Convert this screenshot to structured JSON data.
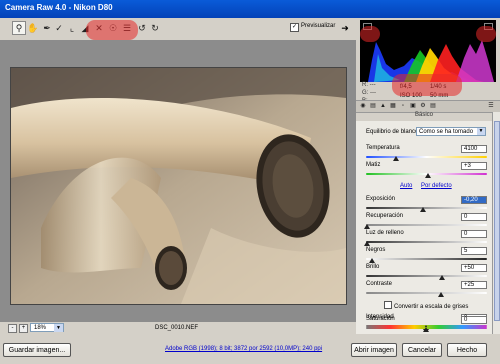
{
  "window": {
    "title": "Camera Raw 4.0  -  Nikon D80"
  },
  "toolbar": {
    "tools": [
      "zoom-icon",
      "hand-icon",
      "eyedropper-icon",
      "color-sampler-icon",
      "crop-icon",
      "straighten-icon",
      "retouch-icon",
      "red-eye-icon",
      "preferences-icon",
      "rotate-left-icon",
      "rotate-right-icon"
    ],
    "preview_label": "Previsualizar",
    "preview_checked": "✓"
  },
  "viewer": {
    "zoom": "18%",
    "filename": "DSC_0010.NEF"
  },
  "rgb": {
    "r_label": "R:",
    "g_label": "G:",
    "b_label": "B:",
    "r": "---",
    "g": "---",
    "b": "---"
  },
  "exif": {
    "aperture": "f/4,5",
    "shutter": "1/40 s",
    "iso": "ISO 100",
    "focal": "50 mm"
  },
  "panel": {
    "section_title": "Básico",
    "wb_label": "Equilibrio de blancos:",
    "wb_value": "Como se ha tomado",
    "temperatura_label": "Temperatura",
    "temperatura_value": "4100",
    "matiz_label": "Matiz",
    "matiz_value": "+3",
    "auto_label": "Auto",
    "defecto_label": "Por defecto",
    "exposicion_label": "Exposición",
    "exposicion_value": "-0,20",
    "recuperacion_label": "Recuperación",
    "recuperacion_value": "0",
    "luz_label": "Luz de relleno",
    "luz_value": "0",
    "negros_label": "Negros",
    "negros_value": "5",
    "brillo_label": "Brillo",
    "brillo_value": "+50",
    "contraste_label": "Contraste",
    "contraste_value": "+25",
    "grises_label": "Convertir a escala de grises",
    "intensidad_label": "Intensidad",
    "intensidad_value": "0",
    "saturacion_label": "Saturación",
    "saturacion_value": "0"
  },
  "bottom": {
    "save_label": "Guardar imagen...",
    "workflow_link": "Adobe RGB (1998); 8 bit; 3872 por 2592 (10,0MP); 240 ppi",
    "open_label": "Abrir imagen",
    "cancel_label": "Cancelar",
    "done_label": "Hecho"
  },
  "colors": {
    "titlebar": "#0548c8",
    "highlight": "#e62828",
    "link": "#0000cc"
  }
}
